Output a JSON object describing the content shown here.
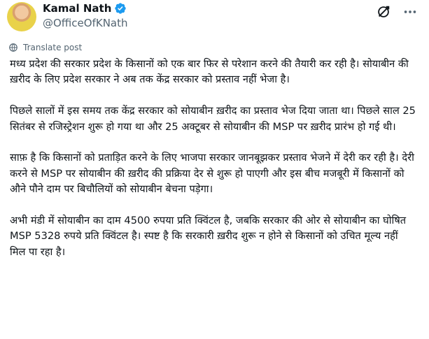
{
  "author": {
    "display_name": "Kamal Nath",
    "handle": "@OfficeOfKNath",
    "verified_color": "#1d9bf0"
  },
  "actions": {
    "grok_icon": "grok-icon",
    "more_icon": "more-icon"
  },
  "translate_label": "Translate post",
  "body": {
    "paragraphs": [
      "मध्य प्रदेश की सरकार प्रदेश के किसानों को एक बार फिर से परेशान करने की तैयारी कर रही है। सोयाबीन की ख़रीद के लिए प्रदेश सरकार ने अब तक केंद्र सरकार को प्रस्ताव नहीं भेजा है।",
      "पिछले सालों में इस समय तक केंद्र सरकार को सोयाबीन ख़रीद का प्रस्ताव भेज दिया जाता था। पिछले साल 25 सितंबर से रजिस्ट्रेशन शुरू हो गया था और 25 अक्टूबर से सोयाबीन की MSP पर ख़रीद प्रारंभ हो गई थी।",
      "साफ़ है कि किसानों को प्रताड़ित करने के लिए भाजपा सरकार जानबूझकर प्रस्ताव भेजने में देरी कर रही है। देरी करने से MSP पर सोयाबीन की ख़रीद की प्रक्रिया देर से शुरू हो पाएगी और इस बीच मजबूरी में किसानों को औने पौने दाम पर बिचौलियों को सोयाबीन बेचना पड़ेगा।",
      "अभी मंडी में सोयाबीन का दाम 4500 रुपया प्रति क्विंटल है, जबकि सरकार की ओर से सोयाबीन का घोषित MSP 5328 रुपये प्रति क्विंटल है। स्पष्ट है कि सरकारी ख़रीद शुरू न होने से किसानों को उचित मूल्य नहीं मिल पा रहा है।"
    ]
  }
}
